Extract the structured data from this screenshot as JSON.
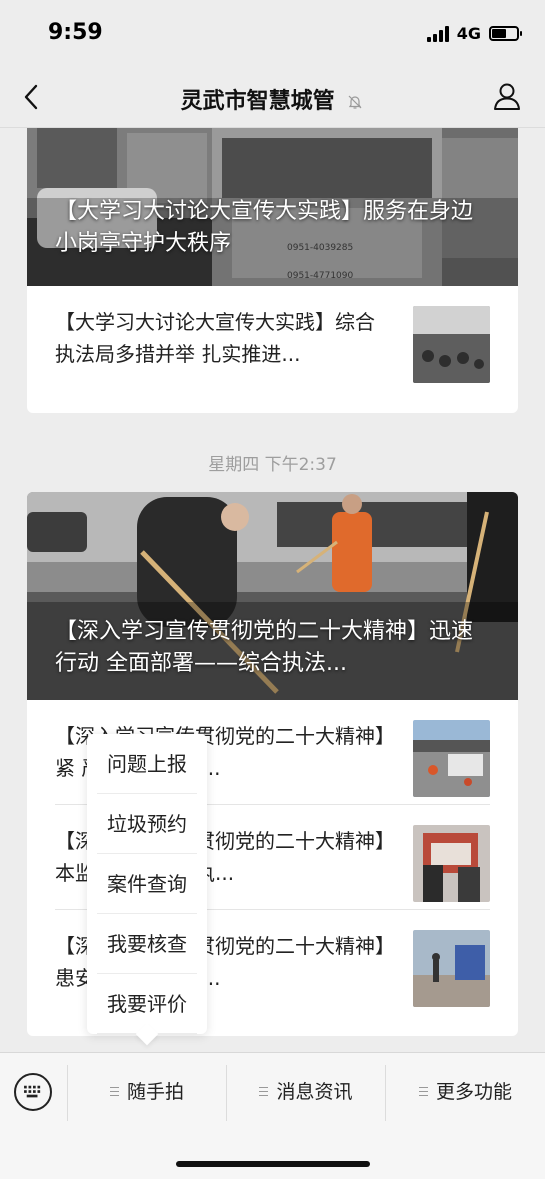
{
  "status": {
    "time": "9:59",
    "network": "4G",
    "battery_level": 0.6
  },
  "nav": {
    "title": "灵武市智慧城管",
    "back_icon": "chevron-left-icon",
    "mute_icon": "bell-off-icon",
    "profile_icon": "user-icon"
  },
  "feed": {
    "card1": {
      "hero_title": "【大学习大讨论大宣传大实践】服务在身边 小岗亭守护大秩序",
      "hero_sign_text": [
        "0951-4039285",
        "0951-4771090"
      ],
      "items": [
        {
          "title": "【大学习大讨论大宣传大实践】综合执法局多措并举 扎实推进..."
        }
      ]
    },
    "timestamp": "星期四 下午2:37",
    "card2": {
      "hero_title": "【深入学习宣传贯彻党的二十大精神】迅速行动 全面部署——综合执法...",
      "items": [
        {
          "title": "【深入学习宣传贯彻党的二十大精神】紧 严阵以待——..."
        },
        {
          "title": "【深入学习宣传贯彻党的二十大精神】本监管责任——执..."
        },
        {
          "title": "【深入学习宣传贯彻党的二十大精神】患安全隐患 搭建..."
        }
      ]
    }
  },
  "popup_menu": {
    "items": [
      "问题上报",
      "垃圾预约",
      "案件查询",
      "我要核查",
      "我要评价"
    ]
  },
  "bottom_menu": {
    "keyboard_icon": "keyboard-icon",
    "items": [
      "随手拍",
      "消息资讯",
      "更多功能"
    ]
  }
}
